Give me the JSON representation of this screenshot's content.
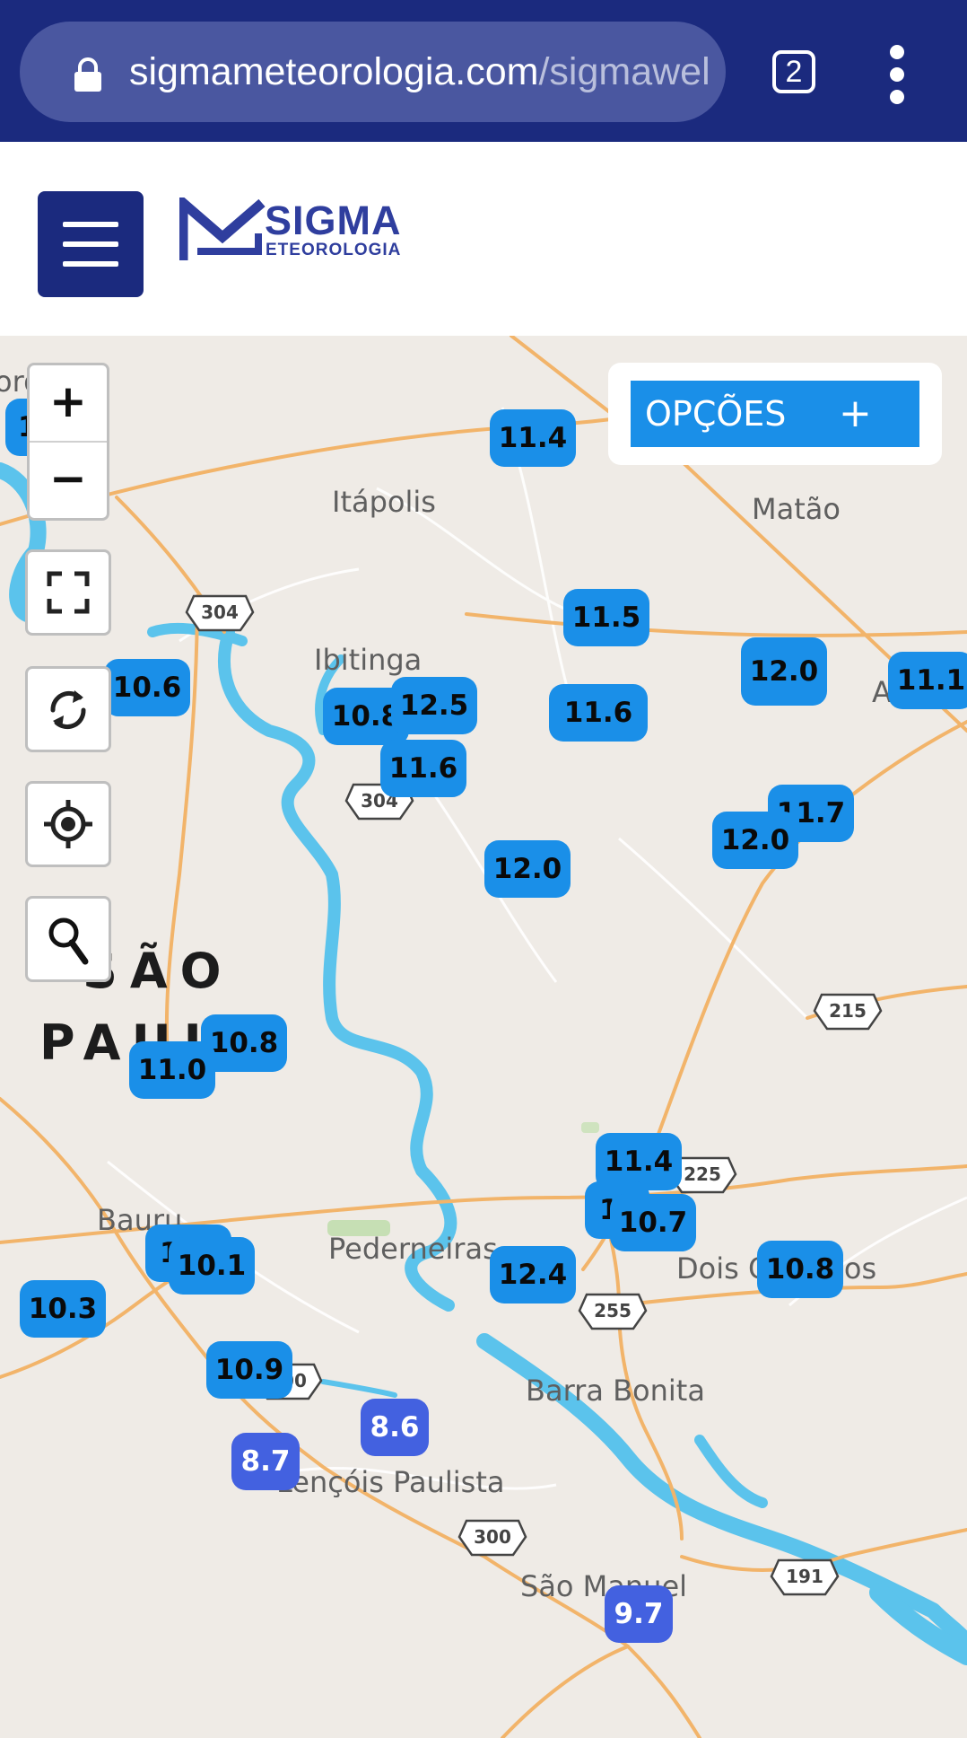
{
  "browser": {
    "url_domain": "sigmameteorologia.com",
    "url_path": "/sigmawel",
    "tab_count": "2"
  },
  "site": {
    "logo_title": "SIGMA",
    "logo_subtitle": "ETEOROLOGIA"
  },
  "map": {
    "options_label": "OPÇÕES",
    "options_plus": "+",
    "zoom_in": "+",
    "zoom_out": "−",
    "state_label_1": "SÃO",
    "state_label_2": "PAUL",
    "places": {
      "itapolis": "Itápolis",
      "matao": "Matão",
      "ibitinga": "Ibitinga",
      "bauru": "Bauru",
      "pederneiras": "Pederneiras",
      "dois_corregos": "Dois Córregos",
      "barra_bonita": "Barra Bonita",
      "lencois": "Lençóis Paulista",
      "sao_manuel": "São Manuel",
      "edge_top_left": "ordide",
      "edge_right": "A"
    },
    "shields": {
      "s304a": "304",
      "s304b": "304",
      "s215": "215",
      "s225": "225",
      "s255": "255",
      "s300a": "300",
      "s300b": "300",
      "s191": "191"
    },
    "markers": [
      {
        "id": "m-edge-tl",
        "value": "1"
      },
      {
        "id": "m-11-4-top",
        "value": "11.4"
      },
      {
        "id": "m-11-5",
        "value": "11.5"
      },
      {
        "id": "m-12-0-a",
        "value": "12.0"
      },
      {
        "id": "m-11-1",
        "value": "11.1"
      },
      {
        "id": "m-10-6",
        "value": "10.6"
      },
      {
        "id": "m-10-8-a",
        "value": "10.8"
      },
      {
        "id": "m-12-5",
        "value": "12.5"
      },
      {
        "id": "m-11-6-a",
        "value": "11.6"
      },
      {
        "id": "m-11-6-b",
        "value": "11.6"
      },
      {
        "id": "m-11-7",
        "value": "11.7"
      },
      {
        "id": "m-12-0-b",
        "value": "12.0"
      },
      {
        "id": "m-12-0-c",
        "value": "12.0"
      },
      {
        "id": "m-10-8-b",
        "value": "10.8"
      },
      {
        "id": "m-11-0",
        "value": "11.0"
      },
      {
        "id": "m-11-4-b",
        "value": "11.4"
      },
      {
        "id": "m-1-hidden",
        "value": "1"
      },
      {
        "id": "m-10-7",
        "value": "10.7"
      },
      {
        "id": "m-1-hidden-b",
        "value": "1"
      },
      {
        "id": "m-10-1",
        "value": "10.1"
      },
      {
        "id": "m-12-4",
        "value": "12.4"
      },
      {
        "id": "m-10-8-c",
        "value": "10.8"
      },
      {
        "id": "m-10-3",
        "value": "10.3"
      },
      {
        "id": "m-10-9",
        "value": "10.9"
      },
      {
        "id": "m-8-6",
        "value": "8.6"
      },
      {
        "id": "m-8-7",
        "value": "8.7"
      },
      {
        "id": "m-9-7",
        "value": "9.7"
      }
    ]
  },
  "colors": {
    "chrome": "#1b2a7e",
    "marker_warm": "#1a8fe8",
    "marker_cool": "#4361e0",
    "water": "#5bc3ec",
    "roads": "#f2b46a"
  }
}
